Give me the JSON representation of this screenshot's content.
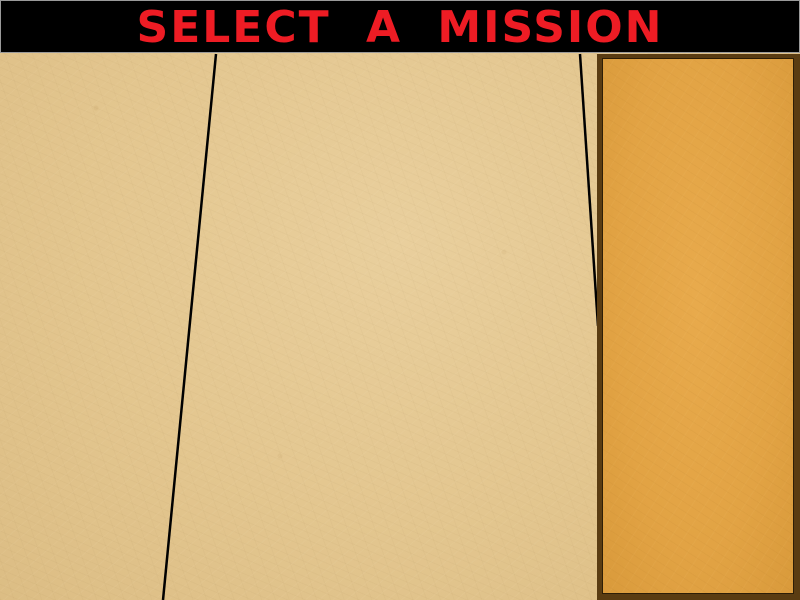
{
  "header": {
    "title": "SELECT A MISSION"
  },
  "colors": {
    "title_text": "#ee1c24",
    "title_bar_bg": "#000000",
    "paper_background": "#e6c994",
    "side_panel_frame": "#5a3c12",
    "side_panel_fill": "#e2a344",
    "path_line": "#000000"
  },
  "side_panel": {
    "missions": []
  }
}
